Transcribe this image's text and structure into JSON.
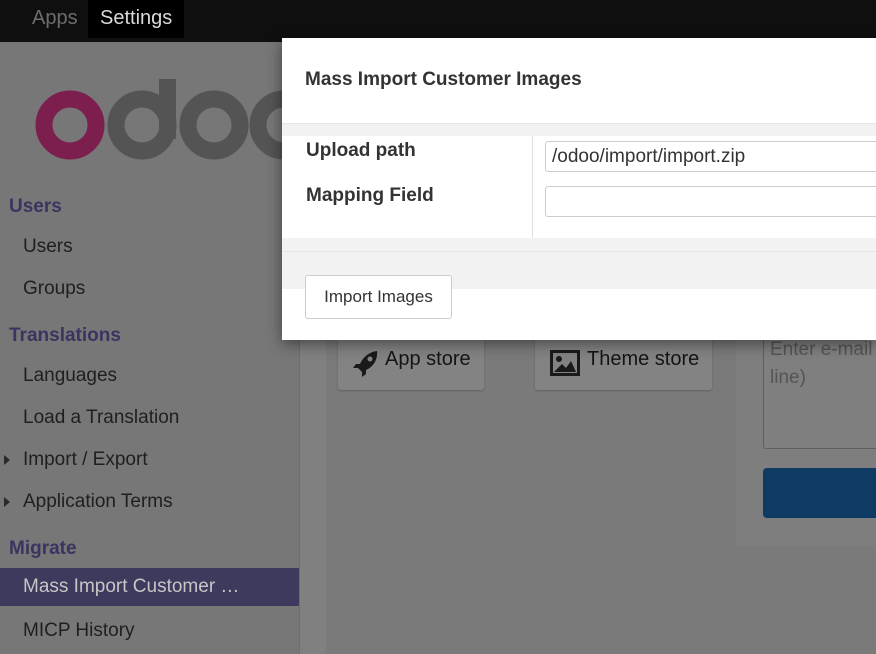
{
  "topbar": {
    "apps_label": "Apps",
    "settings_label": "Settings"
  },
  "sidebar": {
    "logo_text": "odoo",
    "sections": {
      "users": "Users",
      "translations": "Translations",
      "migrate": "Migrate"
    },
    "items": {
      "users": "Users",
      "groups": "Groups",
      "languages": "Languages",
      "load_translation": "Load a Translation",
      "import_export": "Import / Export",
      "application_terms": "Application Terms",
      "mass_import": "Mass Import Customer …",
      "micp_history": "MICP History"
    }
  },
  "main": {
    "app_store_label": "App store",
    "theme_store_label": "Theme store",
    "email_placeholder_line1": "Enter e-mail",
    "email_placeholder_line2": "line)"
  },
  "modal": {
    "title": "Mass Import Customer Images",
    "upload_path_label": "Upload path",
    "upload_path_value": "/odoo/import/import.zip",
    "mapping_field_label": "Mapping Field",
    "mapping_field_value": "",
    "import_button_label": "Import Images"
  },
  "colors": {
    "logo_o": "#7c1f4f",
    "sidebar_section": "#3a3560",
    "active_item_bg": "#3e3a5d",
    "overlay_bg": "#7a7a7a"
  }
}
